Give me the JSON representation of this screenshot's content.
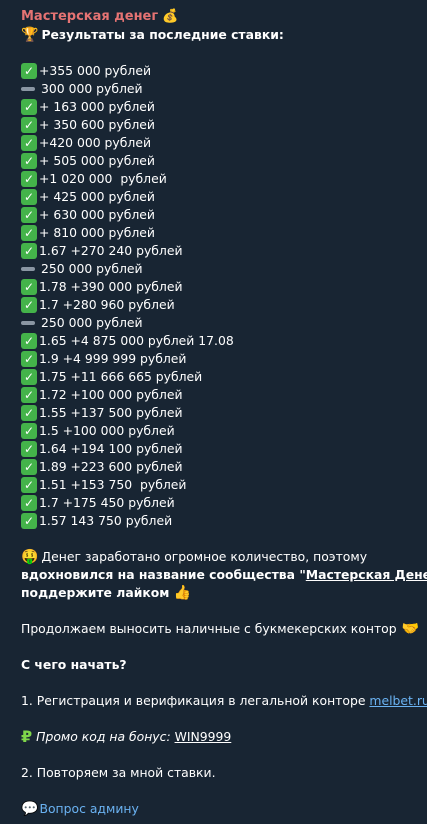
{
  "sender": {
    "name": "Мастерская денег",
    "icon": "money-bag-icon"
  },
  "header": "Результаты за последние ставки:",
  "results": [
    {
      "mark": "check",
      "text": "+355 000 рублей"
    },
    {
      "mark": "dash",
      "text": "300 000 рублей"
    },
    {
      "mark": "check",
      "text": "+ 163 000 рублей"
    },
    {
      "mark": "check",
      "text": "+ 350 600 рублей"
    },
    {
      "mark": "check",
      "text": "+420 000 рублей"
    },
    {
      "mark": "check",
      "text": "+ 505 000 рублей"
    },
    {
      "mark": "check",
      "text": "+1 020 000  рублей"
    },
    {
      "mark": "check",
      "text": "+ 425 000 рублей"
    },
    {
      "mark": "check",
      "text": "+ 630 000 рублей"
    },
    {
      "mark": "check",
      "text": "+ 810 000 рублей"
    },
    {
      "mark": "check",
      "text": "1.67 +270 240 рублей"
    },
    {
      "mark": "dash",
      "text": "250 000 рублей"
    },
    {
      "mark": "check",
      "text": "1.78 +390 000 рублей"
    },
    {
      "mark": "check",
      "text": "1.7 +280 960 рублей"
    },
    {
      "mark": "dash",
      "text": "250 000 рублей"
    },
    {
      "mark": "check",
      "text": "1.65 +4 875 000 рублей 17.08"
    },
    {
      "mark": "check",
      "text": "1.9 +4 999 999 рублей"
    },
    {
      "mark": "check",
      "text": "1.75 +11 666 665 рублей"
    },
    {
      "mark": "check",
      "text": "1.72 +100 000 рублей"
    },
    {
      "mark": "check",
      "text": "1.55 +137 500 рублей"
    },
    {
      "mark": "check",
      "text": "1.5 +100 000 рублей"
    },
    {
      "mark": "check",
      "text": "1.64 +194 100 рублей"
    },
    {
      "mark": "check",
      "text": "1.89 +223 600 рублей"
    },
    {
      "mark": "check",
      "text": "1.51 +153 750  рублей"
    },
    {
      "mark": "check",
      "text": "1.7 +175 450 рублей"
    },
    {
      "mark": "check",
      "text": "1.57 143 750 рублей"
    }
  ],
  "para1": {
    "part1": "Денег заработано огромное количество, поэтому",
    "part2": "вдохновился на название сообщества \"",
    "community": "Мастерская Денег",
    "part3": "\"",
    "part4": "поддержите лайком"
  },
  "para2": "Продолжаем выносить наличные с букмекерских контор",
  "para3": "С чего начать?",
  "step1": {
    "text": "1. Регистрация и верификация в легальной конторе ",
    "link": "melbet.ru"
  },
  "promo": {
    "label": "Промо код на бонус: ",
    "code": "WIN9999"
  },
  "step2": "2. Повторяем за мной ставки.",
  "admin": "Вопрос админу"
}
